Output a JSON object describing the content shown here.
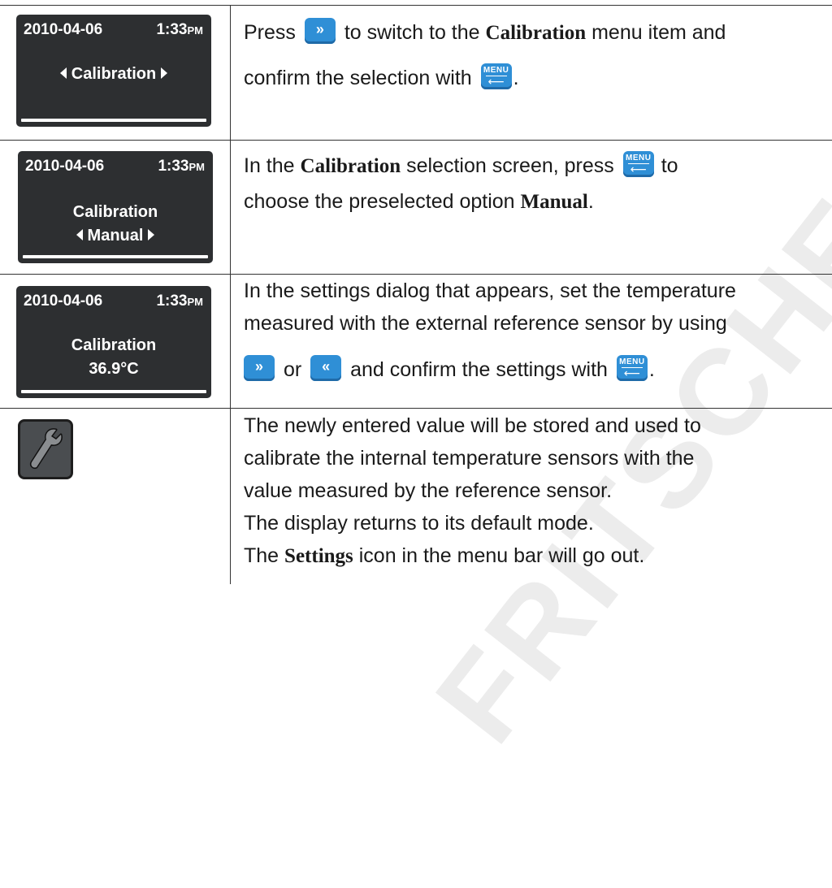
{
  "watermark": "FRITSCHER",
  "rows": [
    {
      "lcd": {
        "date": "2010-04-06",
        "time": "1:33",
        "ampm": "PM",
        "line1": "Calibration",
        "line2": ""
      },
      "text": {
        "l1a": "Press",
        "l1b": "to switch to the",
        "l1c": "Calibration",
        "l1d": "menu item and",
        "l2a": "confirm the selection with",
        "l2b": "."
      }
    },
    {
      "lcd": {
        "date": "2010-04-06",
        "time": "1:33",
        "ampm": "PM",
        "line1": "Calibration",
        "line2": "Manual"
      },
      "text": {
        "l1a": "In the",
        "l1b": "Calibration",
        "l1c": "selection screen, press",
        "l1d": "to",
        "l2a": "choose the preselected option",
        "l2b": "Manual",
        "l2c": "."
      }
    },
    {
      "lcd": {
        "date": "2010-04-06",
        "time": "1:33",
        "ampm": "PM",
        "line1": "Calibration",
        "line2": "36.9°C"
      },
      "text": {
        "l1": "In the settings dialog that appears, set the temperature",
        "l2": "measured with the external reference sensor by using",
        "l3a": "or",
        "l3b": "and confirm the settings with",
        "l3c": "."
      }
    },
    {
      "icon": "wrench-icon",
      "text": {
        "l1": "The newly entered value will be stored and used to",
        "l2": "calibrate the internal temperature sensors with the",
        "l3": "value measured by the reference sensor.",
        "l4": "The display returns to its default mode.",
        "l5a": "The",
        "l5b": "Settings",
        "l5c": "icon in the menu bar will go out."
      }
    }
  ],
  "buttons": {
    "menu_label": "MENU",
    "enter_glyph": "⟵",
    "right_glyph": "»",
    "left_glyph": "«"
  },
  "colors": {
    "button_blue": "#2f8fd6",
    "lcd_bg": "#2d2f31"
  }
}
